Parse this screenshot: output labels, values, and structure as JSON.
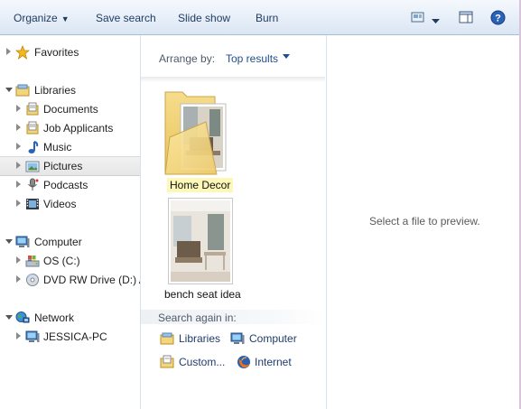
{
  "toolbar": {
    "organize_label": "Organize",
    "save_search_label": "Save search",
    "slide_show_label": "Slide show",
    "burn_label": "Burn",
    "views_icon": "views-icon",
    "preview_pane_icon": "preview-pane-icon",
    "help_icon": "help-icon"
  },
  "nav": {
    "favorites": "Favorites",
    "libraries": "Libraries",
    "library_items": [
      "Documents",
      "Job Applicants",
      "Music",
      "Pictures",
      "Podcasts",
      "Videos"
    ],
    "computer": "Computer",
    "computer_items": [
      "OS (C:)",
      "DVD RW Drive (D:) A"
    ],
    "network": "Network",
    "network_items": [
      "JESSICA-PC"
    ],
    "selected": "Pictures"
  },
  "center": {
    "arrange_by_label": "Arrange by:",
    "arrange_by_value": "Top results",
    "items": [
      {
        "label": "Home Decor",
        "type": "folder"
      },
      {
        "label": "bench seat idea",
        "type": "image"
      }
    ],
    "search_again_label": "Search again in:",
    "search_locations": [
      "Libraries",
      "Computer",
      "Custom...",
      "Internet"
    ]
  },
  "preview": {
    "message": "Select a file to preview."
  },
  "colors": {
    "toolbar_text": "#1e3a5f",
    "link_blue": "#1f4e8c",
    "highlight_yellow": "#fdf7b8",
    "pane_border": "#d6e2f0"
  }
}
